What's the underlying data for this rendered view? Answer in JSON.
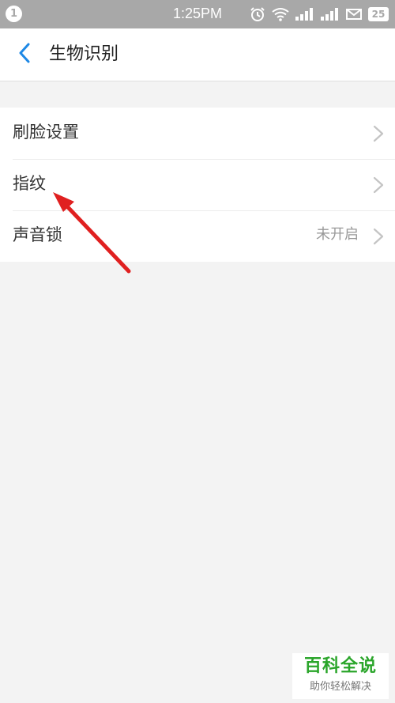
{
  "status_bar": {
    "notification_count": "1",
    "time": "1:25PM",
    "battery": "25",
    "icons": [
      "alarm-icon",
      "wifi-icon",
      "signal-icon",
      "signal-icon",
      "mail-icon",
      "battery-icon"
    ]
  },
  "header": {
    "back_icon": "chevron-left-icon",
    "title": "生物识别"
  },
  "list": {
    "items": [
      {
        "label": "刷脸设置",
        "value": ""
      },
      {
        "label": "指纹",
        "value": ""
      },
      {
        "label": "声音锁",
        "value": "未开启"
      }
    ]
  },
  "watermark": {
    "title": "百科全说",
    "subtitle": "助你轻松解决"
  },
  "colors": {
    "accent": "#1e88e5",
    "status_bar": "#a8a8a8",
    "background": "#f3f3f3",
    "annotation_arrow": "#e02020",
    "watermark_green": "#2aa52a"
  }
}
